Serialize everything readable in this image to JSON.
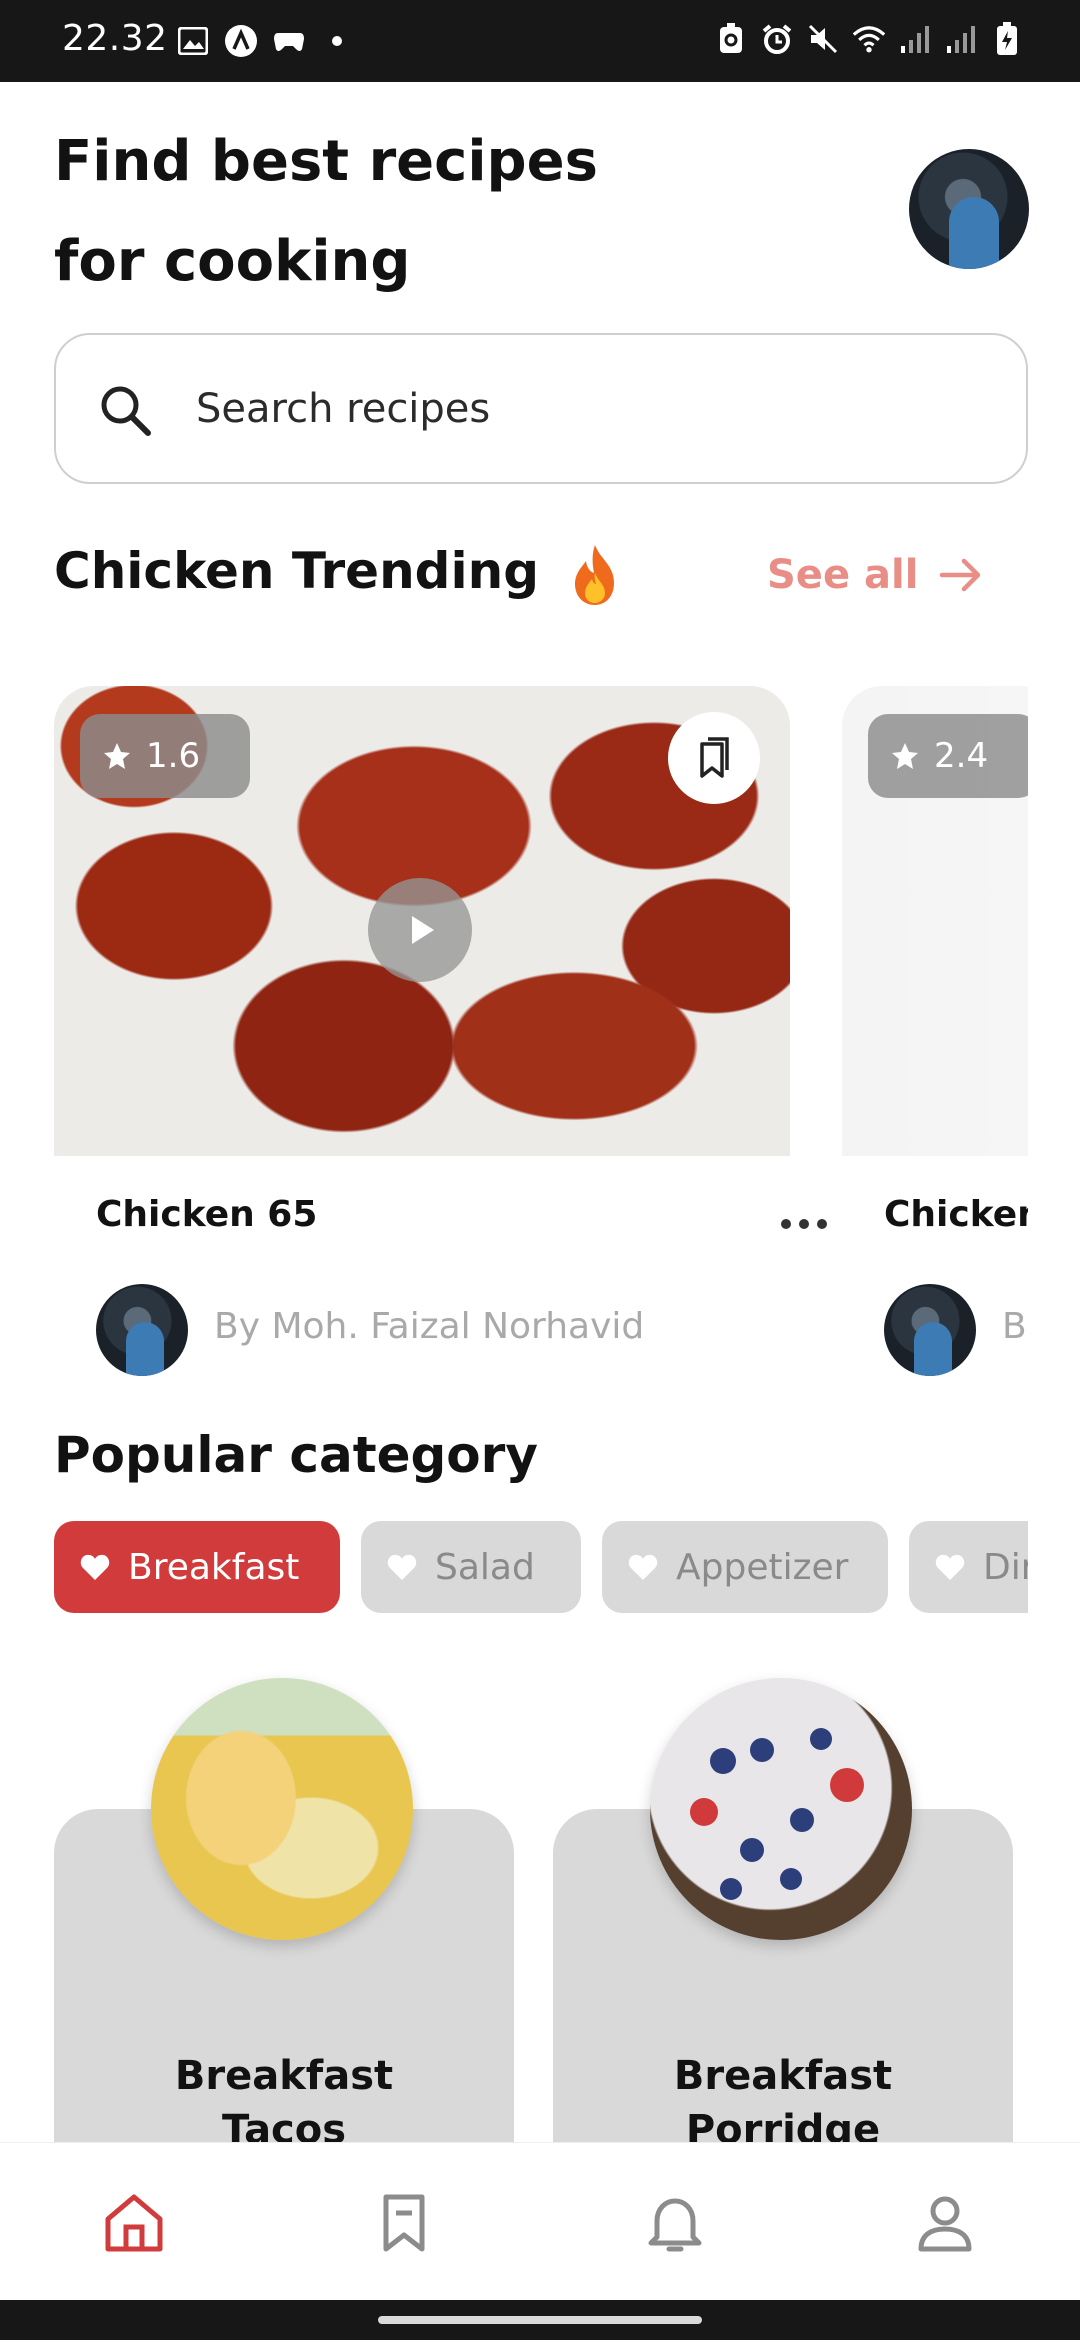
{
  "status_bar": {
    "time": "22.32",
    "left_icons": [
      "gallery-icon",
      "app-icon",
      "game-icon",
      "dot-icon"
    ],
    "right_icons": [
      "battery-saver-icon",
      "alarm-icon",
      "mute-icon",
      "wifi-icon",
      "signal-icon",
      "signal-icon",
      "battery-icon"
    ]
  },
  "header": {
    "title_line1": "Find best recipes",
    "title_line2": "for cooking"
  },
  "search": {
    "placeholder": "Search recipes",
    "value": ""
  },
  "trending": {
    "title": "Chicken Trending",
    "see_all": "See all",
    "cards": [
      {
        "name": "Chicken 65",
        "rating": "1.6",
        "author": "By Moh. Faizal Norhavid"
      },
      {
        "name": "Chicken",
        "rating": "2.4",
        "author": "By"
      }
    ]
  },
  "popular": {
    "title": "Popular category",
    "chips": [
      "Breakfast",
      "Salad",
      "Appetizer",
      "Dir"
    ],
    "active_chip": "Breakfast",
    "recipes": [
      {
        "name_line1": "Breakfast",
        "name_line2": "Tacos"
      },
      {
        "name_line1": "Breakfast",
        "name_line2": "Porridge"
      }
    ]
  },
  "bottom_nav": [
    "home-icon",
    "bookmark-icon",
    "bell-icon",
    "profile-icon"
  ],
  "colors": {
    "accent": "#d23b3b",
    "see_all": "#e98d87",
    "chip_bg": "#d9d9d9"
  }
}
